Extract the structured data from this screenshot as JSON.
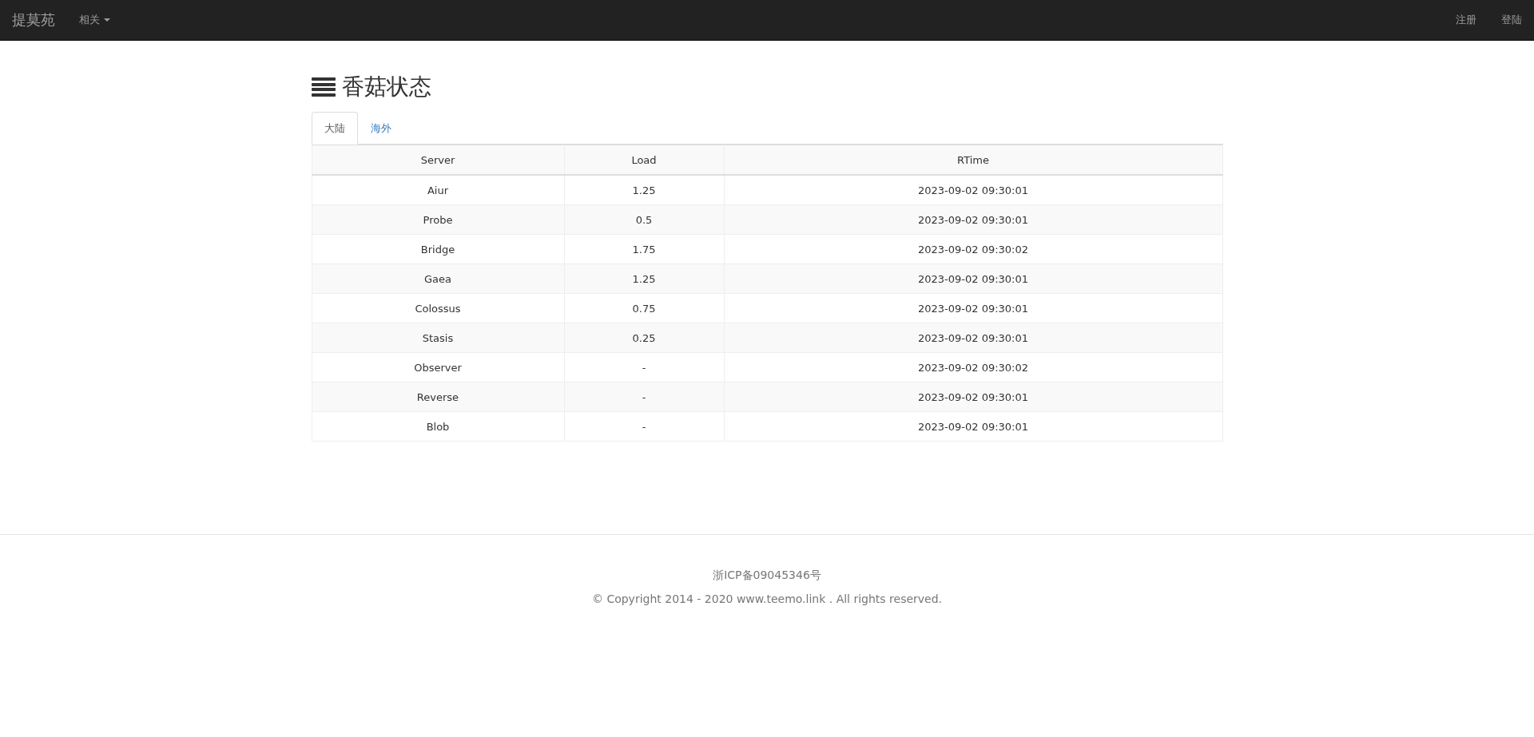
{
  "navbar": {
    "brand": "提莫苑",
    "menu": [
      {
        "label": "相关",
        "dropdown": true
      }
    ],
    "right": [
      "注册",
      "登陆"
    ]
  },
  "page": {
    "title": "香菇状态",
    "tabs": [
      {
        "label": "大陆",
        "selected": true
      },
      {
        "label": "海外",
        "selected": false
      }
    ],
    "table": {
      "columns": [
        "Server",
        "Load",
        "RTime"
      ],
      "rows": [
        [
          "Aiur",
          "1.25",
          "2023-09-02 09:30:01"
        ],
        [
          "Probe",
          "0.5",
          "2023-09-02 09:30:01"
        ],
        [
          "Bridge",
          "1.75",
          "2023-09-02 09:30:02"
        ],
        [
          "Gaea",
          "1.25",
          "2023-09-02 09:30:01"
        ],
        [
          "Colossus",
          "0.75",
          "2023-09-02 09:30:01"
        ],
        [
          "Stasis",
          "0.25",
          "2023-09-02 09:30:01"
        ],
        [
          "Observer",
          "-",
          "2023-09-02 09:30:02"
        ],
        [
          "Reverse",
          "-",
          "2023-09-02 09:30:01"
        ],
        [
          "Blob",
          "-",
          "2023-09-02 09:30:01"
        ]
      ]
    }
  },
  "footer": {
    "license": "浙ICP备09045346号",
    "copyright": "© Copyright 2014 - 2020 www.teemo.link . All rights reserved."
  }
}
